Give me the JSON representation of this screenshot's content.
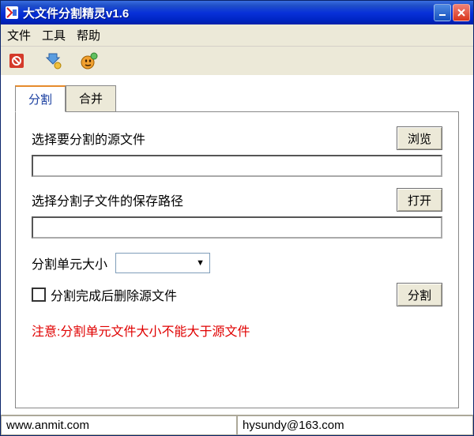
{
  "titlebar": {
    "title": "大文件分割精灵v1.6"
  },
  "menubar": {
    "file": "文件",
    "tools": "工具",
    "help": "帮助"
  },
  "tabs": {
    "split": "分割",
    "merge": "合并"
  },
  "panel": {
    "source_label": "选择要分割的源文件",
    "browse_btn": "浏览",
    "source_value": "",
    "dest_label": "选择分割子文件的保存路径",
    "open_btn": "打开",
    "dest_value": "",
    "unit_label": "分割单元大小",
    "unit_value": "",
    "delete_checkbox_label": "分割完成后删除源文件",
    "split_btn": "分割",
    "warning": "注意:分割单元文件大小不能大于源文件"
  },
  "statusbar": {
    "left": "www.anmit.com",
    "right": "hysundy@163.com"
  }
}
